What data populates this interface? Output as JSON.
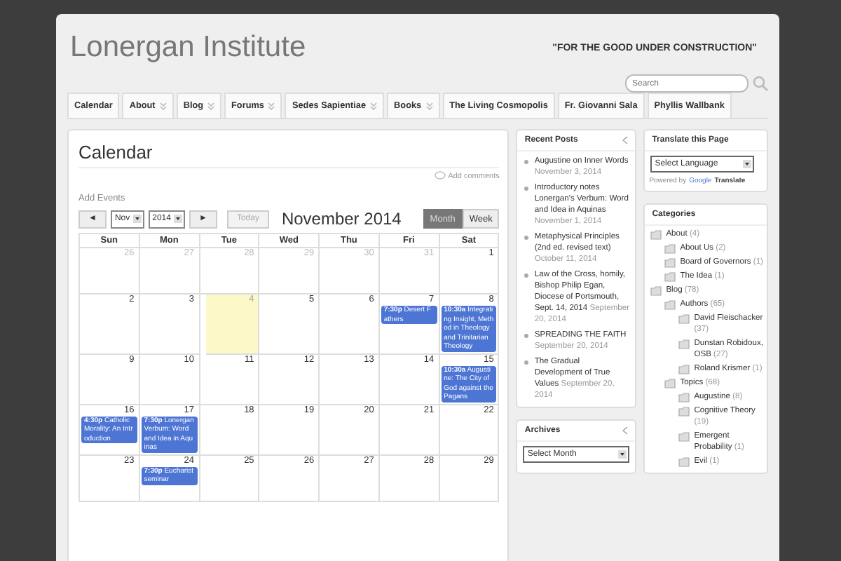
{
  "site": {
    "title": "Lonergan Institute",
    "tagline": "\"FOR THE GOOD UNDER CONSTRUCTION\"",
    "search": {
      "placeholder": "Search"
    }
  },
  "nav": [
    {
      "label": "Calendar",
      "has_submenu": false
    },
    {
      "label": "About",
      "has_submenu": true
    },
    {
      "label": "Blog",
      "has_submenu": true
    },
    {
      "label": "Forums",
      "has_submenu": true
    },
    {
      "label": "Sedes Sapientiae",
      "has_submenu": true
    },
    {
      "label": "Books",
      "has_submenu": true
    },
    {
      "label": "The Living Cosmopolis",
      "has_submenu": false
    },
    {
      "label": "Fr. Giovanni Sala",
      "has_submenu": false
    },
    {
      "label": "Phyllis Wallbank",
      "has_submenu": false
    }
  ],
  "page": {
    "title": "Calendar",
    "comments_link": "Add comments",
    "add_events": "Add Events"
  },
  "calendar": {
    "prev": "◄",
    "next": "►",
    "month_select": "Nov",
    "year_select": "2014",
    "today": "Today",
    "heading": "November 2014",
    "views": [
      {
        "label": "Month",
        "selected": true
      },
      {
        "label": "Week",
        "selected": false
      }
    ],
    "weekdays": [
      "Sun",
      "Mon",
      "Tue",
      "Wed",
      "Thu",
      "Fri",
      "Sat"
    ],
    "weeks": [
      [
        {
          "day": "26",
          "muted": true
        },
        {
          "day": "27",
          "muted": true
        },
        {
          "day": "28",
          "muted": true
        },
        {
          "day": "29",
          "muted": true
        },
        {
          "day": "30",
          "muted": true
        },
        {
          "day": "31",
          "muted": true
        },
        {
          "day": "1",
          "muted": false
        }
      ],
      [
        {
          "day": "2",
          "muted": false
        },
        {
          "day": "3",
          "muted": false
        },
        {
          "day": "4",
          "muted": false,
          "today": true
        },
        {
          "day": "5",
          "muted": false
        },
        {
          "day": "6",
          "muted": false
        },
        {
          "day": "7",
          "muted": false,
          "events": [
            {
              "time": "7:30p",
              "title": "Desert Fathers"
            }
          ]
        },
        {
          "day": "8",
          "muted": false,
          "events": [
            {
              "time": "10:30a",
              "title": "Integrating Insight, Method in Theology and Trinitarian Theology"
            }
          ]
        }
      ],
      [
        {
          "day": "9",
          "muted": false
        },
        {
          "day": "10",
          "muted": false
        },
        {
          "day": "11",
          "muted": false
        },
        {
          "day": "12",
          "muted": false
        },
        {
          "day": "13",
          "muted": false
        },
        {
          "day": "14",
          "muted": false
        },
        {
          "day": "15",
          "muted": false,
          "events": [
            {
              "time": "10:30a",
              "title": "Augustine: The City of God against the Pagans"
            }
          ]
        }
      ],
      [
        {
          "day": "16",
          "muted": false,
          "events": [
            {
              "time": "4:30p",
              "title": "Catholic Morality: An Introduction"
            }
          ]
        },
        {
          "day": "17",
          "muted": false,
          "events": [
            {
              "time": "7:30p",
              "title": "Lonergan Verbum: Word and Idea in Aquinas"
            }
          ]
        },
        {
          "day": "18",
          "muted": false
        },
        {
          "day": "19",
          "muted": false
        },
        {
          "day": "20",
          "muted": false
        },
        {
          "day": "21",
          "muted": false
        },
        {
          "day": "22",
          "muted": false
        }
      ],
      [
        {
          "day": "23",
          "muted": false
        },
        {
          "day": "24",
          "muted": false,
          "events": [
            {
              "time": "7:30p",
              "title": "Eucharist seminar"
            }
          ]
        },
        {
          "day": "25",
          "muted": false
        },
        {
          "day": "26",
          "muted": false
        },
        {
          "day": "27",
          "muted": false
        },
        {
          "day": "28",
          "muted": false
        },
        {
          "day": "29",
          "muted": false
        }
      ]
    ]
  },
  "recent_posts": {
    "title": "Recent Posts",
    "items": [
      {
        "title": "Augustine on Inner Words",
        "date": "November 3, 2014"
      },
      {
        "title": "Introductory notes Lonergan's Verbum: Word and Idea in Aquinas",
        "date": "November 1, 2014"
      },
      {
        "title": "Metaphysical Principles (2nd ed. revised text)",
        "date": "October 11, 2014"
      },
      {
        "title": "Law of the Cross, homily, Bishop Philip Egan, Diocese of Portsmouth, Sept. 14, 2014",
        "date": "September 20, 2014"
      },
      {
        "title": "SPREADING THE FAITH",
        "date": "September 20, 2014"
      },
      {
        "title": "The Gradual Development of True Values",
        "date": "September 20, 2014"
      }
    ]
  },
  "archives": {
    "title": "Archives",
    "select": "Select Month"
  },
  "translate": {
    "title": "Translate this Page",
    "select": "Select Language",
    "powered_by": "Powered by",
    "google": "Google",
    "translate": "Translate"
  },
  "categories": {
    "title": "Categories",
    "items": [
      {
        "name": "About",
        "count": "(4)",
        "children": [
          {
            "name": "About Us",
            "count": "(2)"
          },
          {
            "name": "Board of Governors",
            "count": "(1)"
          },
          {
            "name": "The Idea",
            "count": "(1)"
          }
        ]
      },
      {
        "name": "Blog",
        "count": "(78)",
        "children": [
          {
            "name": "Authors",
            "count": "(65)",
            "children": [
              {
                "name": "David Fleischacker",
                "count": "(37)"
              },
              {
                "name": "Dunstan Robidoux, OSB",
                "count": "(27)"
              },
              {
                "name": "Roland Krismer",
                "count": "(1)"
              }
            ]
          },
          {
            "name": "Topics",
            "count": "(68)",
            "children": [
              {
                "name": "Augustine",
                "count": "(8)"
              },
              {
                "name": "Cognitive Theory",
                "count": "(19)"
              },
              {
                "name": "Emergent Probability",
                "count": "(1)"
              },
              {
                "name": "Evil",
                "count": "(1)"
              }
            ]
          }
        ]
      }
    ]
  }
}
